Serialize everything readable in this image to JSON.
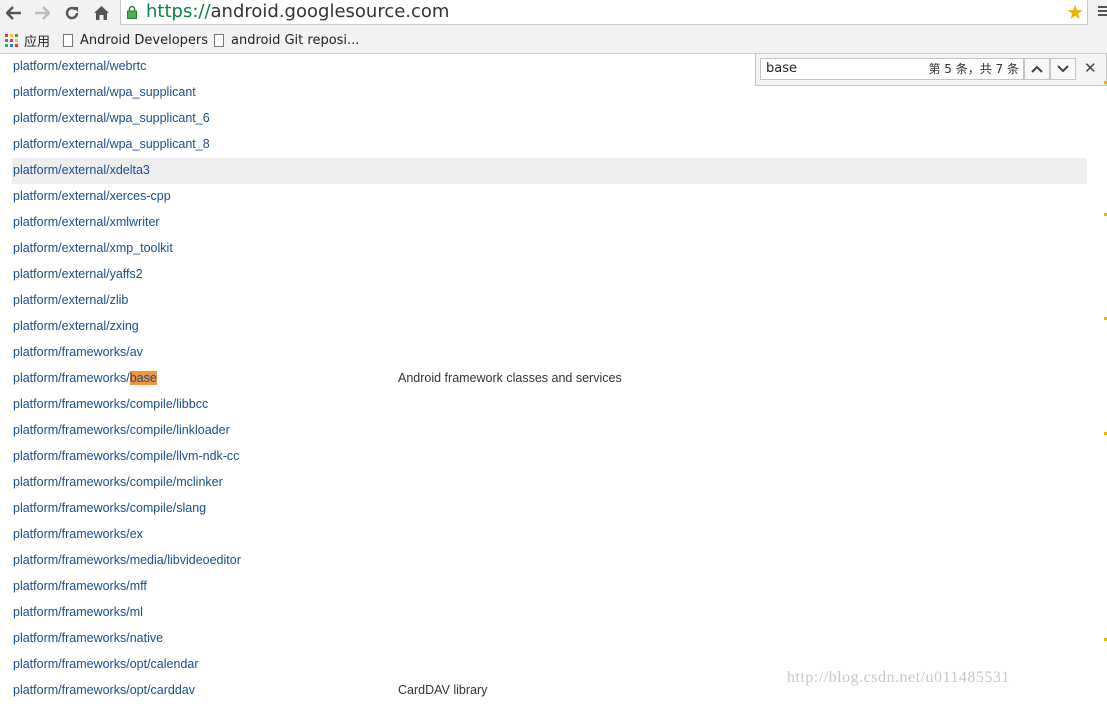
{
  "browser": {
    "url_scheme": "https://",
    "url_host": "android.googlesource.com"
  },
  "bookmarks": [
    {
      "label": "应用"
    },
    {
      "label": "Android Developers"
    },
    {
      "label": "android Git reposi..."
    }
  ],
  "find_bar": {
    "query": "base",
    "count": "第 5 条，共 7 条"
  },
  "repos": [
    {
      "path": "platform/external/webrtc",
      "desc": ""
    },
    {
      "path": "platform/external/wpa_supplicant",
      "desc": ""
    },
    {
      "path": "platform/external/wpa_supplicant_6",
      "desc": ""
    },
    {
      "path": "platform/external/wpa_supplicant_8",
      "desc": ""
    },
    {
      "path": "platform/external/xdelta3",
      "desc": ""
    },
    {
      "path": "platform/external/xerces-cpp",
      "desc": ""
    },
    {
      "path": "platform/external/xmlwriter",
      "desc": ""
    },
    {
      "path": "platform/external/xmp_toolkit",
      "desc": ""
    },
    {
      "path": "platform/external/yaffs2",
      "desc": ""
    },
    {
      "path": "platform/external/zlib",
      "desc": ""
    },
    {
      "path": "platform/external/zxing",
      "desc": ""
    },
    {
      "path": "platform/frameworks/av",
      "desc": ""
    },
    {
      "path_prefix": "platform/frameworks/",
      "path_match": "base",
      "desc": "Android framework classes and services"
    },
    {
      "path": "platform/frameworks/compile/libbcc",
      "desc": ""
    },
    {
      "path": "platform/frameworks/compile/linkloader",
      "desc": ""
    },
    {
      "path": "platform/frameworks/compile/llvm-ndk-cc",
      "desc": ""
    },
    {
      "path": "platform/frameworks/compile/mclinker",
      "desc": ""
    },
    {
      "path": "platform/frameworks/compile/slang",
      "desc": ""
    },
    {
      "path": "platform/frameworks/ex",
      "desc": ""
    },
    {
      "path": "platform/frameworks/media/libvideoeditor",
      "desc": ""
    },
    {
      "path": "platform/frameworks/mff",
      "desc": ""
    },
    {
      "path": "platform/frameworks/ml",
      "desc": ""
    },
    {
      "path": "platform/frameworks/native",
      "desc": ""
    },
    {
      "path": "platform/frameworks/opt/calendar",
      "desc": ""
    },
    {
      "path": "platform/frameworks/opt/carddav",
      "desc": "CardDAV library"
    }
  ],
  "watermark": "http://blog.csdn.net/u011485531",
  "colors": {
    "link": "#1a4f8b",
    "match_highlight": "#f3953f",
    "secure_green": "#0b8043",
    "star": "#e8b800"
  }
}
